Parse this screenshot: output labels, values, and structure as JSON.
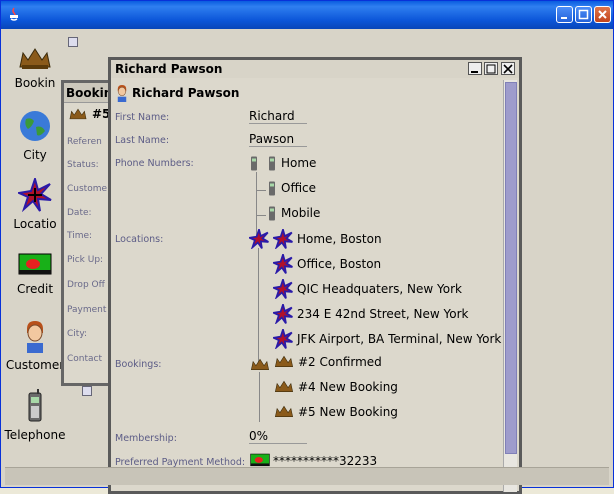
{
  "sidebar": {
    "icons": [
      {
        "name": "booking",
        "label": "Bookin"
      },
      {
        "name": "city",
        "label": "City"
      },
      {
        "name": "location",
        "label": "Locatio"
      },
      {
        "name": "credit",
        "label": "Credit"
      },
      {
        "name": "customer",
        "label": "Customer"
      },
      {
        "name": "telephone",
        "label": "Telephone"
      }
    ]
  },
  "booking_window": {
    "title": "Booking",
    "header": "#5",
    "labels": [
      "Referen",
      "Status:",
      "Custome",
      "Date:",
      "Time:",
      "Pick Up:",
      "Drop Off",
      "Payment",
      "City:",
      "Contact"
    ]
  },
  "person_window": {
    "title": "Richard Pawson",
    "header": "Richard Pawson",
    "fields": {
      "first_name_label": "First Name:",
      "first_name": "Richard",
      "last_name_label": "Last Name:",
      "last_name": "Pawson",
      "phones_label": "Phone Numbers:",
      "phones": [
        "Home",
        "Office",
        "Mobile"
      ],
      "locations_label": "Locations:",
      "locations": [
        "Home, Boston",
        "Office, Boston",
        "QIC Headquaters, New York",
        "234 E 42nd Street, New York",
        "JFK Airport, BA Terminal, New York"
      ],
      "bookings_label": "Bookings:",
      "bookings": [
        "#2 Confirmed",
        "#4 New Booking",
        "#5 New Booking"
      ],
      "membership_label": "Membership:",
      "membership": "0%",
      "payment_label": "Preferred Payment Method:",
      "payment": "***********32233"
    }
  },
  "colors": {
    "titlebar": "#0b55d8",
    "label": "#5c5c86",
    "scroll_thumb": "#9e9ccc"
  }
}
